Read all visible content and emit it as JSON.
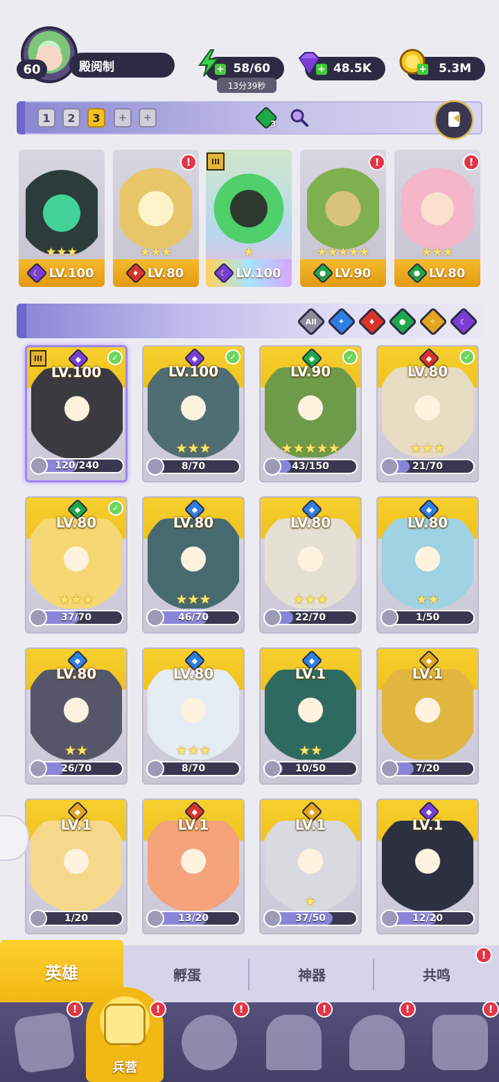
{
  "player": {
    "level": "60",
    "name": "殿阅制"
  },
  "resources": {
    "stamina": "58/60",
    "stamina_timer": "13分39秒",
    "gems": "48.5K",
    "gold": "5.3M"
  },
  "team_bar": {
    "slots": [
      "1",
      "2",
      "3",
      "+",
      "+"
    ],
    "active_slot": "3",
    "element_count": "3"
  },
  "lineup": [
    {
      "level": "LV.100",
      "element": "dark",
      "stars": "★★★",
      "alert": false
    },
    {
      "level": "LV.80",
      "element": "fire",
      "stars": "★★★",
      "alert": true
    },
    {
      "level": "LV.100",
      "element": "dark",
      "stars": "★",
      "alert": false,
      "tier": "III"
    },
    {
      "level": "LV.90",
      "element": "nature",
      "stars": "★★★★★",
      "alert": true
    },
    {
      "level": "LV.80",
      "element": "nature",
      "stars": "★★★",
      "alert": true
    }
  ],
  "filters": [
    {
      "label": "All",
      "color": "#8c8a9c"
    },
    {
      "label": "",
      "color": "#2f7fe0",
      "name": "water"
    },
    {
      "label": "",
      "color": "#d9342a",
      "name": "fire"
    },
    {
      "label": "",
      "color": "#1ea84a",
      "name": "nature"
    },
    {
      "label": "",
      "color": "#e4a41c",
      "name": "light"
    },
    {
      "label": "",
      "color": "#7a3dd6",
      "name": "dark"
    }
  ],
  "heroes": [
    {
      "level": "LV.100",
      "shard": "120/240",
      "fill": 0.5,
      "element": "#7a3dd6",
      "check": true,
      "tier": "III",
      "stars": "",
      "art": "#3a3a40"
    },
    {
      "level": "LV.100",
      "shard": "8/70",
      "fill": 0.11,
      "element": "#7a3dd6",
      "check": true,
      "stars": "★★★",
      "art": "#4f6d73"
    },
    {
      "level": "LV.90",
      "shard": "43/150",
      "fill": 0.29,
      "element": "#1ea84a",
      "check": true,
      "stars": "★★★★★",
      "art": "#6f9a4a"
    },
    {
      "level": "LV.80",
      "shard": "21/70",
      "fill": 0.3,
      "element": "#d9342a",
      "check": true,
      "stars": "★★★",
      "art": "#e8dcc2"
    },
    {
      "level": "LV.80",
      "shard": "37/70",
      "fill": 0.53,
      "element": "#1ea84a",
      "check": true,
      "stars": "★★★",
      "art": "#f5d873"
    },
    {
      "level": "LV.80",
      "shard": "46/70",
      "fill": 0.66,
      "element": "#2f7fe0",
      "check": false,
      "stars": "★★★",
      "art": "#466a70"
    },
    {
      "level": "LV.80",
      "shard": "22/70",
      "fill": 0.31,
      "element": "#2f7fe0",
      "check": false,
      "stars": "★★★",
      "art": "#e5e0d4"
    },
    {
      "level": "LV.80",
      "shard": "1/50",
      "fill": 0.02,
      "element": "#2f7fe0",
      "check": false,
      "stars": "★★",
      "art": "#9fd2e2"
    },
    {
      "level": "LV.80",
      "shard": "26/70",
      "fill": 0.37,
      "element": "#2f7fe0",
      "check": false,
      "stars": "★★",
      "art": "#55566a"
    },
    {
      "level": "LV.80",
      "shard": "8/70",
      "fill": 0.11,
      "element": "#2f7fe0",
      "check": false,
      "stars": "★★★",
      "art": "#e6ecf4"
    },
    {
      "level": "LV.1",
      "shard": "10/50",
      "fill": 0.2,
      "element": "#2f7fe0",
      "check": false,
      "stars": "★★",
      "art": "#2f6a60"
    },
    {
      "level": "LV.1",
      "shard": "7/20",
      "fill": 0.35,
      "element": "#e4a41c",
      "check": false,
      "stars": "",
      "art": "#e0b540"
    },
    {
      "level": "LV.1",
      "shard": "1/20",
      "fill": 0.05,
      "element": "#e4a41c",
      "check": false,
      "stars": "",
      "art": "#f6d88a"
    },
    {
      "level": "LV.1",
      "shard": "13/20",
      "fill": 0.65,
      "element": "#d9342a",
      "check": false,
      "stars": "",
      "art": "#f4a37a"
    },
    {
      "level": "LV.1",
      "shard": "37/50",
      "fill": 0.74,
      "element": "#e4a41c",
      "check": false,
      "stars": "★",
      "art": "#d8dae0"
    },
    {
      "level": "LV.1",
      "shard": "12/20",
      "fill": 0.6,
      "element": "#7a3dd6",
      "check": false,
      "stars": "",
      "art": "#2c3040"
    }
  ],
  "subtabs": [
    "英雄",
    "孵蛋",
    "神器",
    "共鸣"
  ],
  "nav": {
    "active_label": "兵营"
  }
}
